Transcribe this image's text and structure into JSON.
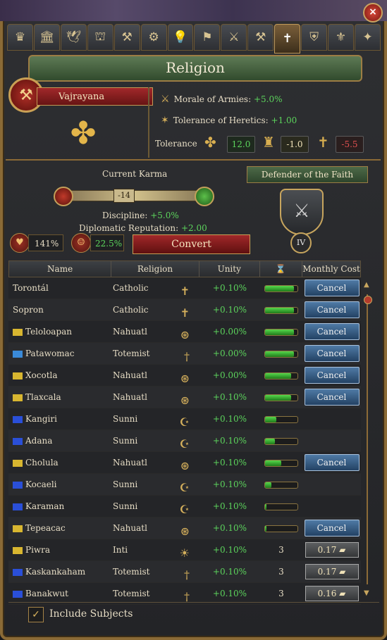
{
  "window": {
    "title": "Religion",
    "close_icon": "×"
  },
  "tabs": [
    {
      "icon": "♛"
    },
    {
      "icon": "🏛"
    },
    {
      "icon": "🕊"
    },
    {
      "icon": "⛫"
    },
    {
      "icon": "⚒"
    },
    {
      "icon": "⚙"
    },
    {
      "icon": "💡"
    },
    {
      "icon": "⚑"
    },
    {
      "icon": "⚔"
    },
    {
      "icon": "⚒"
    },
    {
      "icon": "✝",
      "active": true
    },
    {
      "icon": "⛨"
    },
    {
      "icon": "⚜"
    },
    {
      "icon": "✦"
    }
  ],
  "religion": {
    "name": "Vajrayana",
    "morale_label": "Morale of Armies:",
    "morale_value": "+5.0%",
    "heretics_label": "Tolerance of Heretics:",
    "heretics_value": "+1.00",
    "tolerance_label": "Tolerance",
    "tolerance_true": "12.0",
    "tolerance_heretic": "-1.0",
    "tolerance_heathen": "-5.5"
  },
  "karma": {
    "title": "Current Karma",
    "value": "-14",
    "discipline_label": "Discipline:",
    "discipline_value": "+5.0%",
    "diplo_label": "Diplomatic Reputation:",
    "diplo_value": "+2.00",
    "pct1": "141%",
    "pct2": "22.5%",
    "convert_label": "Convert",
    "defender_label": "Defender of the Faith",
    "defender_rank": "IV"
  },
  "table": {
    "headers": [
      "Name",
      "Religion",
      "Unity",
      "⌛",
      "Monthly Cost"
    ],
    "rows": [
      {
        "name": "Torontál",
        "flag": "",
        "religion": "Catholic",
        "icon": "✝",
        "unity": "+0.10%",
        "progress": 0.9,
        "action": "Cancel"
      },
      {
        "name": "Sopron",
        "flag": "",
        "religion": "Catholic",
        "icon": "✝",
        "unity": "+0.10%",
        "progress": 0.9,
        "action": "Cancel"
      },
      {
        "name": "Teloloapan",
        "flag": "#d8b630",
        "religion": "Nahuatl",
        "icon": "⊛",
        "unity": "+0.00%",
        "progress": 0.9,
        "action": "Cancel"
      },
      {
        "name": "Patawomac",
        "flag": "#3a8ad8",
        "religion": "Totemist",
        "icon": "†",
        "unity": "+0.00%",
        "progress": 0.9,
        "action": "Cancel"
      },
      {
        "name": "Xocotla",
        "flag": "#d8b630",
        "religion": "Nahuatl",
        "icon": "⊛",
        "unity": "+0.00%",
        "progress": 0.8,
        "action": "Cancel"
      },
      {
        "name": "Tlaxcala",
        "flag": "#d8b630",
        "religion": "Nahuatl",
        "icon": "⊛",
        "unity": "+0.10%",
        "progress": 0.8,
        "action": "Cancel"
      },
      {
        "name": "Kangiri",
        "flag": "#2a4fd8",
        "religion": "Sunni",
        "icon": "☪",
        "unity": "+0.10%",
        "progress": 0.35,
        "action": ""
      },
      {
        "name": "Adana",
        "flag": "#2a4fd8",
        "religion": "Sunni",
        "icon": "☪",
        "unity": "+0.10%",
        "progress": 0.3,
        "action": ""
      },
      {
        "name": "Cholula",
        "flag": "#d8b630",
        "religion": "Nahuatl",
        "icon": "⊛",
        "unity": "+0.10%",
        "progress": 0.5,
        "action": "Cancel"
      },
      {
        "name": "Kocaeli",
        "flag": "#2a4fd8",
        "religion": "Sunni",
        "icon": "☪",
        "unity": "+0.10%",
        "progress": 0.2,
        "action": ""
      },
      {
        "name": "Karaman",
        "flag": "#2a4fd8",
        "religion": "Sunni",
        "icon": "☪",
        "unity": "+0.10%",
        "progress": 0.05,
        "action": ""
      },
      {
        "name": "Tepeacac",
        "flag": "#d8b630",
        "religion": "Nahuatl",
        "icon": "⊛",
        "unity": "+0.10%",
        "progress": 0.05,
        "action": "Cancel"
      },
      {
        "name": "Piwra",
        "flag": "#d8b630",
        "religion": "Inti",
        "icon": "☀",
        "unity": "+0.10%",
        "months": "3",
        "cost": "0.17"
      },
      {
        "name": "Kaskankaham",
        "flag": "#2a4fd8",
        "religion": "Totemist",
        "icon": "†",
        "unity": "+0.10%",
        "months": "3",
        "cost": "0.17"
      },
      {
        "name": "Banakwut",
        "flag": "#2a4fd8",
        "religion": "Totemist",
        "icon": "†",
        "unity": "+0.10%",
        "months": "3",
        "cost": "0.16"
      }
    ]
  },
  "footer": {
    "include_subjects": "Include Subjects"
  }
}
